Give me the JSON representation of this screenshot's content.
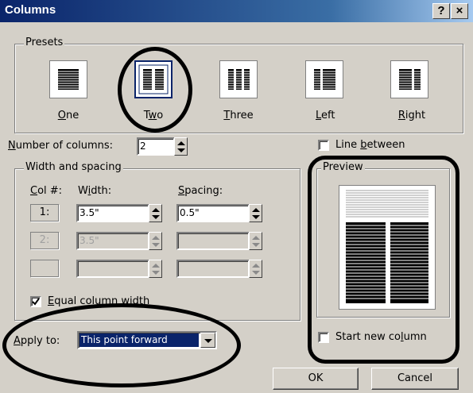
{
  "window": {
    "title": "Columns",
    "help_label": "?",
    "close_label": "×"
  },
  "presets": {
    "group_label": "Presets",
    "items": [
      {
        "label": "One",
        "accelerator": "O",
        "icon": "one-column-icon",
        "selected": false
      },
      {
        "label": "Two",
        "accelerator": "w",
        "icon": "two-column-icon",
        "selected": true
      },
      {
        "label": "Three",
        "accelerator": "T",
        "icon": "three-column-icon",
        "selected": false
      },
      {
        "label": "Left",
        "accelerator": "L",
        "icon": "left-column-icon",
        "selected": false
      },
      {
        "label": "Right",
        "accelerator": "R",
        "icon": "right-column-icon",
        "selected": false
      }
    ]
  },
  "number_of_columns": {
    "label": "Number of columns:",
    "value": "2"
  },
  "line_between": {
    "label": "Line between",
    "checked": false
  },
  "width_spacing": {
    "group_label": "Width and spacing",
    "col_header": "Col #:",
    "width_header": "Width:",
    "spacing_header": "Spacing:",
    "rows": [
      {
        "col": "1:",
        "width": "3.5\"",
        "spacing": "0.5\"",
        "enabled": true
      },
      {
        "col": "2:",
        "width": "3.5\"",
        "spacing": "",
        "enabled": false
      },
      {
        "col": "",
        "width": "",
        "spacing": "",
        "enabled": false
      }
    ],
    "equal_width": {
      "label": "Equal column width",
      "checked": true
    }
  },
  "preview": {
    "group_label": "Preview"
  },
  "apply_to": {
    "label": "Apply to:",
    "value": "This point forward"
  },
  "start_new_column": {
    "label": "Start new column",
    "checked": false
  },
  "buttons": {
    "ok": "OK",
    "cancel": "Cancel"
  },
  "colors": {
    "dialog_bg": "#d4d0c8",
    "titlebar": "#0a246a",
    "selection": "#0a246a",
    "annotation": "#000000"
  }
}
